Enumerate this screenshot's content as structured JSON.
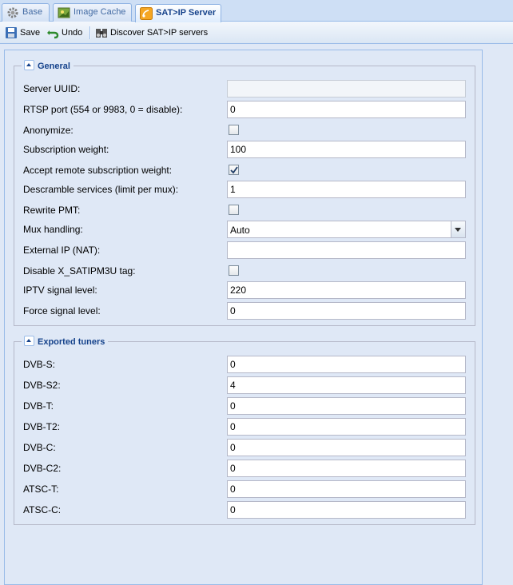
{
  "tabs": [
    {
      "label": "Base",
      "icon": "gear-icon",
      "active": false
    },
    {
      "label": "Image Cache",
      "icon": "image-cache-icon",
      "active": false
    },
    {
      "label": "SAT>IP Server",
      "icon": "satip-server-icon",
      "active": true
    }
  ],
  "toolbar": {
    "save_label": "Save",
    "undo_label": "Undo",
    "discover_label": "Discover SAT>IP servers"
  },
  "general": {
    "legend": "General",
    "server_uuid": {
      "label": "Server UUID:",
      "value": ""
    },
    "rtsp_port": {
      "label": "RTSP port (554 or 9983, 0 = disable):",
      "value": "0"
    },
    "anonymize": {
      "label": "Anonymize:",
      "checked": false
    },
    "subscription_weight": {
      "label": "Subscription weight:",
      "value": "100"
    },
    "accept_remote_weight": {
      "label": "Accept remote subscription weight:",
      "checked": true
    },
    "descramble_services": {
      "label": "Descramble services (limit per mux):",
      "value": "1"
    },
    "rewrite_pmt": {
      "label": "Rewrite PMT:",
      "checked": false
    },
    "mux_handling": {
      "label": "Mux handling:",
      "value": "Auto"
    },
    "external_ip": {
      "label": "External IP (NAT):",
      "value": ""
    },
    "disable_tag": {
      "label": "Disable X_SATIPM3U tag:",
      "checked": false
    },
    "iptv_signal": {
      "label": "IPTV signal level:",
      "value": "220"
    },
    "force_signal": {
      "label": "Force signal level:",
      "value": "0"
    }
  },
  "tuners": {
    "legend": "Exported tuners",
    "rows": [
      {
        "label": "DVB-S:",
        "value": "0"
      },
      {
        "label": "DVB-S2:",
        "value": "4"
      },
      {
        "label": "DVB-T:",
        "value": "0"
      },
      {
        "label": "DVB-T2:",
        "value": "0"
      },
      {
        "label": "DVB-C:",
        "value": "0"
      },
      {
        "label": "DVB-C2:",
        "value": "0"
      },
      {
        "label": "ATSC-T:",
        "value": "0"
      },
      {
        "label": "ATSC-C:",
        "value": "0"
      }
    ]
  },
  "colors": {
    "accent": "#15428b",
    "panel_bg": "#dfe8f6",
    "border": "#99bbe8"
  }
}
